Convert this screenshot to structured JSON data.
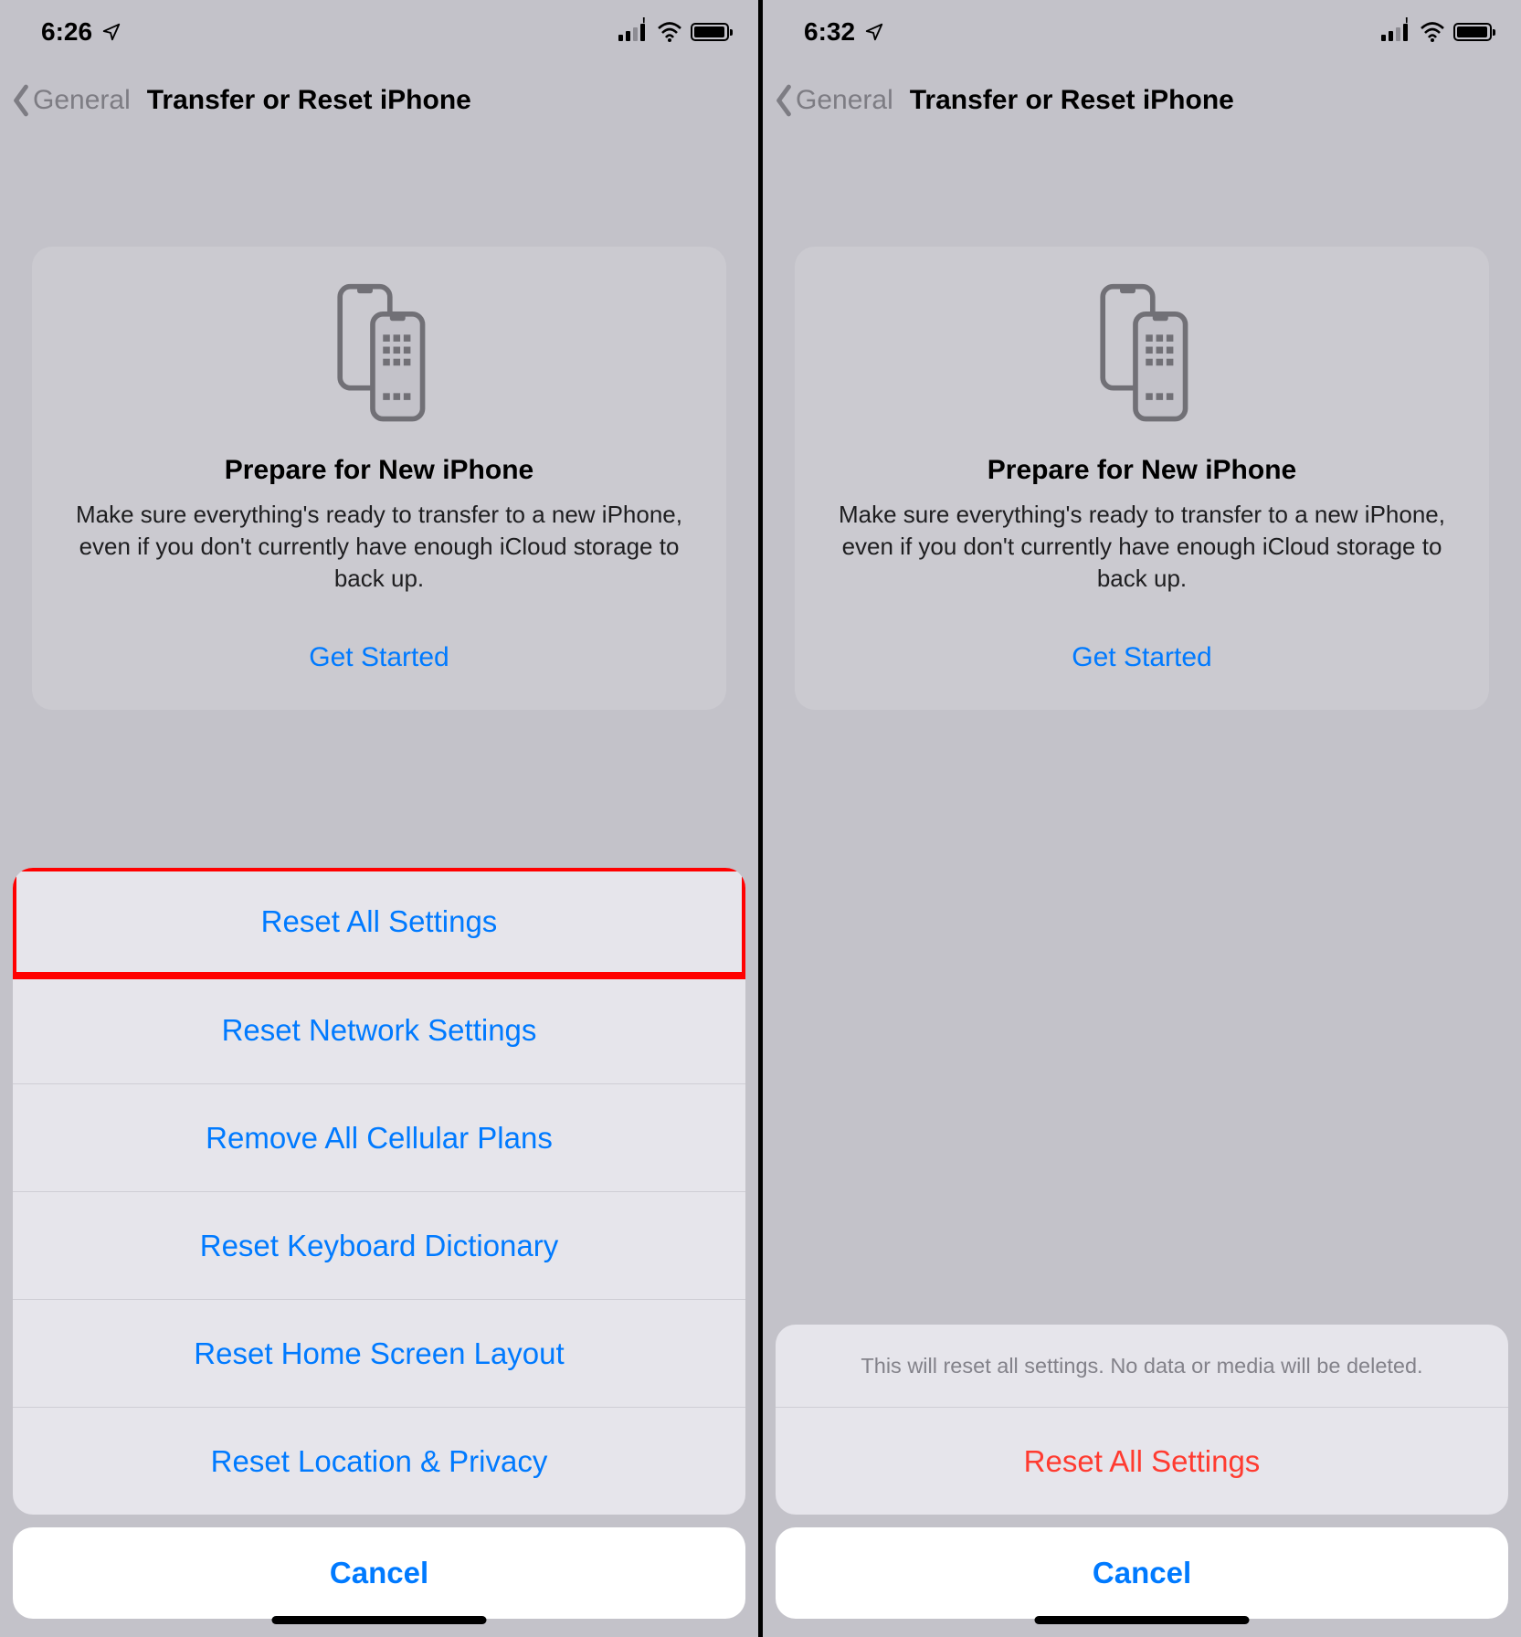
{
  "left": {
    "status": {
      "time": "6:26"
    },
    "nav": {
      "back": "General",
      "title": "Transfer or Reset iPhone"
    },
    "card": {
      "title": "Prepare for New iPhone",
      "desc": "Make sure everything's ready to transfer to a new iPhone, even if you don't currently have enough iCloud storage to back up.",
      "action": "Get Started"
    },
    "sheet": {
      "items": [
        "Reset All Settings",
        "Reset Network Settings",
        "Remove All Cellular Plans",
        "Reset Keyboard Dictionary",
        "Reset Home Screen Layout",
        "Reset Location & Privacy"
      ],
      "cancel": "Cancel"
    }
  },
  "right": {
    "status": {
      "time": "6:32"
    },
    "nav": {
      "back": "General",
      "title": "Transfer or Reset iPhone"
    },
    "card": {
      "title": "Prepare for New iPhone",
      "desc": "Make sure everything's ready to transfer to a new iPhone, even if you don't currently have enough iCloud storage to back up.",
      "action": "Get Started"
    },
    "confirm": {
      "message": "This will reset all settings. No data or media will be deleted.",
      "action": "Reset All Settings",
      "cancel": "Cancel"
    }
  }
}
